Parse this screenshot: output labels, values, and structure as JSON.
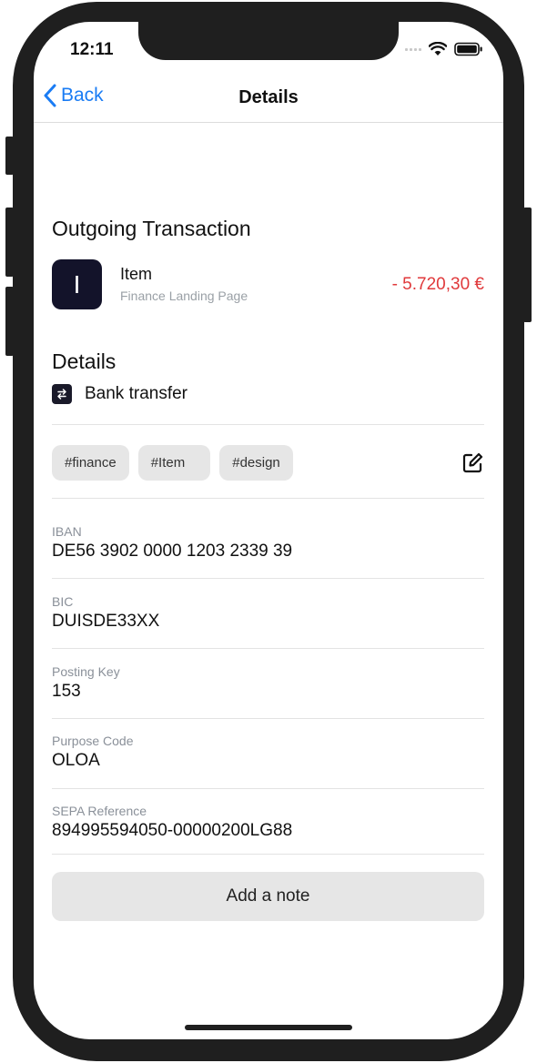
{
  "status_bar": {
    "time": "12:11"
  },
  "nav": {
    "back_label": "Back",
    "title": "Details"
  },
  "transaction": {
    "heading": "Outgoing Transaction",
    "avatar_letter": "I",
    "name": "Item",
    "subtitle": "Finance Landing Page",
    "amount": "- 5.720,30 €",
    "amount_color": "#e0393b"
  },
  "details": {
    "heading": "Details",
    "method_icon": "transfer-arrows-icon",
    "method_label": "Bank transfer"
  },
  "tags": [
    "#finance",
    "#Item",
    "#design"
  ],
  "fields": [
    {
      "label": "IBAN",
      "value": "DE56 3902 0000 1203 2339 39"
    },
    {
      "label": "BIC",
      "value": "DUISDE33XX"
    },
    {
      "label": "Posting Key",
      "value": "153"
    },
    {
      "label": "Purpose Code",
      "value": "OLOA"
    },
    {
      "label": "SEPA Reference",
      "value": "894995594050-00000200LG88"
    }
  ],
  "add_note_label": "Add a note",
  "colors": {
    "accent": "#1a7cf4",
    "negative": "#e0393b",
    "tag_bg": "#e6e6e6"
  }
}
